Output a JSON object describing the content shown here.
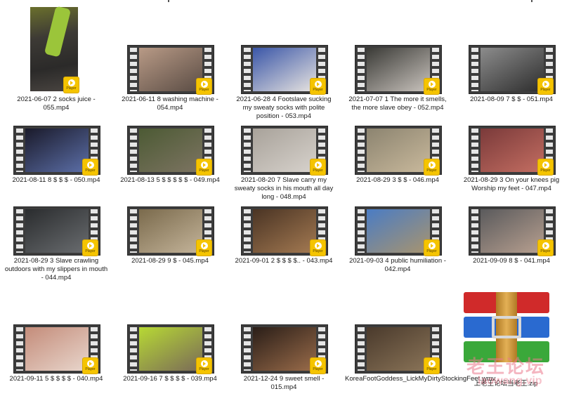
{
  "badge_label": "Player",
  "files": [
    {
      "id": "f01",
      "caption": "2021-06-07 2 socks juice - 055.mp4",
      "colors": [
        "#6e7a3a",
        "#2f2c28"
      ]
    },
    {
      "id": "f02",
      "caption": "2021-06-11 8 washing machine - 054.mp4",
      "colors": [
        "#b89a86",
        "#5a4c44"
      ]
    },
    {
      "id": "f03",
      "caption": "2021-06-28 4 Footslave sucking my sweaty socks with polite position - 053.mp4",
      "colors": [
        "#3a56a8",
        "#e8e4e0"
      ]
    },
    {
      "id": "f04",
      "caption": "2021-07-07 1 The more it smells, the more slave obey - 052.mp4",
      "colors": [
        "#3a3a36",
        "#c9c3bd"
      ]
    },
    {
      "id": "f05",
      "caption": "2021-08-09 7 $ $ - 051.mp4",
      "colors": [
        "#8c8c8c",
        "#2d2d2d"
      ]
    },
    {
      "id": "f06",
      "caption": "2021-08-11 8 $ $ $ - 050.mp4",
      "colors": [
        "#1a1a2a",
        "#5c6fa8"
      ]
    },
    {
      "id": "f07",
      "caption": "2021-08-13 5 $ $ $ $ $ - 049.mp4",
      "colors": [
        "#4c5a34",
        "#7d7462"
      ]
    },
    {
      "id": "f08",
      "caption": "2021-08-20 7 Slave carry my sweaty socks in his mouth all day long - 048.mp4",
      "colors": [
        "#a8a29a",
        "#d7d2cc"
      ]
    },
    {
      "id": "f09",
      "caption": "2021-08-29 3 $ $ - 046.mp4",
      "colors": [
        "#8c8470",
        "#c9b99c"
      ]
    },
    {
      "id": "f10",
      "caption": "2021-08-29 3 On your knees pig  Worship my feet - 047.mp4",
      "colors": [
        "#7a3a3a",
        "#c46e62"
      ]
    },
    {
      "id": "f11",
      "caption": "2021-08-29 3 Slave crawling outdoors with my slippers in mouth - 044.mp4",
      "colors": [
        "#2a2c2e",
        "#6a6d70"
      ]
    },
    {
      "id": "f12",
      "caption": "2021-08-29 9 $ - 045.mp4",
      "colors": [
        "#7a6a4c",
        "#c4b49a"
      ]
    },
    {
      "id": "f13",
      "caption": "2021-09-01 2 $ $ $ $.. - 043.mp4",
      "colors": [
        "#4a3424",
        "#a47a52"
      ]
    },
    {
      "id": "f14",
      "caption": "2021-09-03 4 public humiliation - 042.mp4",
      "colors": [
        "#4a7cc4",
        "#a8946e"
      ]
    },
    {
      "id": "f15",
      "caption": "2021-09-09 8 $ - 041.mp4",
      "colors": [
        "#5a5a5c",
        "#b8a090"
      ]
    },
    {
      "id": "f16",
      "caption": "2021-09-11 5 $ $ $ $ - 040.mp4",
      "colors": [
        "#c48c7a",
        "#e8d6cc"
      ]
    },
    {
      "id": "f17",
      "caption": "2021-09-16 7 $ $ $ $ - 039.mp4",
      "colors": [
        "#b7d934",
        "#7a6a58"
      ]
    },
    {
      "id": "f18",
      "caption": "2021-12-24 9 sweet smell - 015.mp4",
      "colors": [
        "#2a1e18",
        "#9a6c4a"
      ]
    },
    {
      "id": "f19",
      "caption": "KoreaFootGoddess_LickMyDirtyStockingFeet.wmv",
      "colors": [
        "#4a3a2c",
        "#8a7458"
      ]
    }
  ],
  "archive": {
    "caption": "上老王论坛当老王.zip",
    "book_colors": [
      "#d02a2a",
      "#2a6ad0",
      "#3aa83a"
    ]
  },
  "watermark": {
    "line1": "老王论坛",
    "line2": "laowang.vip"
  }
}
